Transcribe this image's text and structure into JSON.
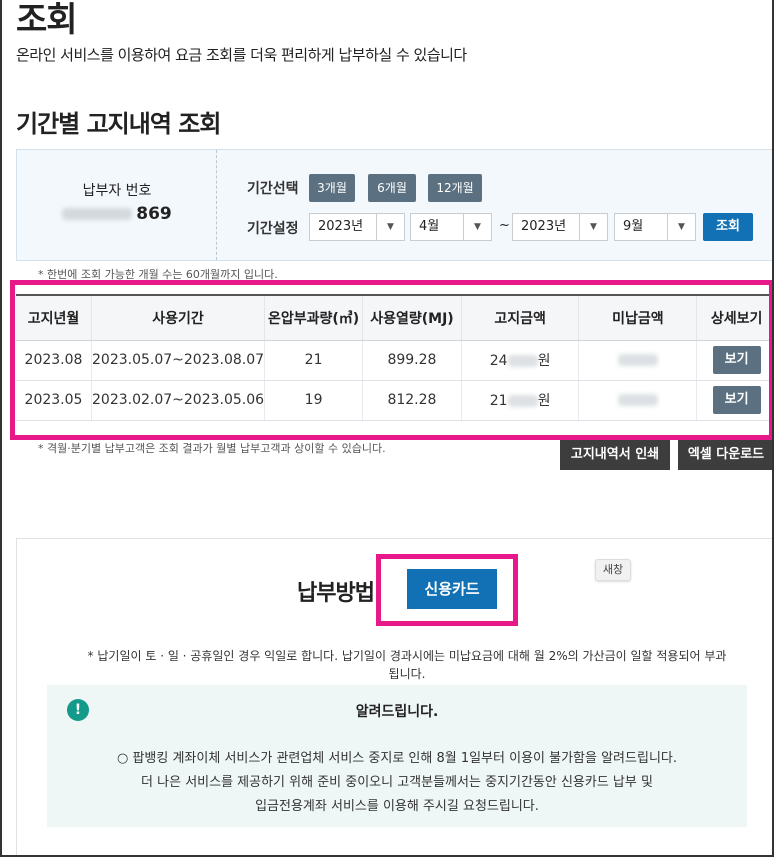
{
  "page": {
    "title": "조회",
    "subtitle": "온라인 서비스를 이용하여 요금 조회를 더욱 편리하게 납부하실 수 있습니다"
  },
  "period_query": {
    "section_title": "기간별 고지내역 조회",
    "payer_label": "납부자 번호",
    "payer_number_visible": "869",
    "period_select_label": "기간선택",
    "period_chips": [
      "3개월",
      "6개월",
      "12개월"
    ],
    "period_setting_label": "기간설정",
    "from_year": "2023년",
    "from_month": "4월",
    "tilde": "~",
    "to_year": "2023년",
    "to_month": "9월",
    "query_button": "조회",
    "note": "* 한번에 조회 가능한 개월 수는 60개월까지 입니다."
  },
  "table": {
    "headers": [
      "고지년월",
      "사용기간",
      "온압부과량(㎥)",
      "사용열량(MJ)",
      "고지금액",
      "미납금액",
      "상세보기"
    ],
    "rows": [
      {
        "ym": "2023.08",
        "period": "2023.05.07~2023.08.07",
        "volume": "21",
        "heat": "899.28",
        "amount_prefix": "24",
        "amount_suffix": "원",
        "view": "보기"
      },
      {
        "ym": "2023.05",
        "period": "2023.02.07~2023.05.06",
        "volume": "19",
        "heat": "812.28",
        "amount_prefix": "21",
        "amount_suffix": "원",
        "view": "보기"
      }
    ],
    "note": "* 격월·분기별 납부고객은 조회 결과가 월별 납부고객과 상이할 수 있습니다."
  },
  "actions": {
    "print_button": "고지내역서 인쇄",
    "excel_button": "엑셀 다운로드"
  },
  "payment": {
    "title": "납부방법",
    "card_button": "신용카드",
    "new_window": "새창",
    "note": "* 납기일이 토 · 일 · 공휴일인 경우 익일로 합니다. 납기일이 경과시에는 미납요금에 대해 월 2%의 가산금이 일할 적용되어 부과됩니다."
  },
  "notice": {
    "icon": "!",
    "title": "알려드립니다.",
    "line1": "○ 팝뱅킹 계좌이체 서비스가 관련업체 서비스 중지로 인해 8월 1일부터 이용이 불가함을 알려드립니다.",
    "line2": "더 나은 서비스를 제공하기 위해 준비 중이오니 고객분들께서는 중지기간동안 신용카드 납부 및",
    "line3": "입금전용계좌 서비스를 이용해 주시길 요청드립니다."
  },
  "colors": {
    "highlight": "#e6188a",
    "primary_button": "#1271b5",
    "chip": "#5b7080"
  }
}
